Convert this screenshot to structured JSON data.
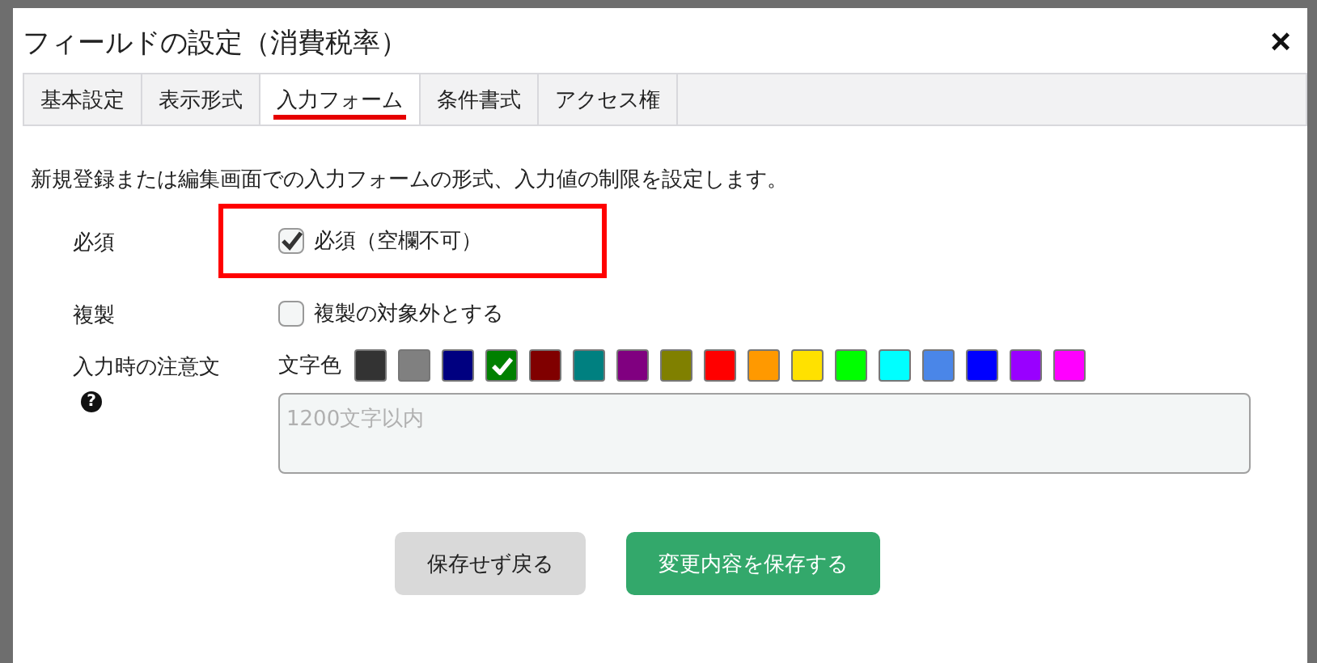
{
  "dialog": {
    "title": "フィールドの設定（消費税率）",
    "close": "×"
  },
  "tabs": [
    {
      "label": "基本設定",
      "selected": false
    },
    {
      "label": "表示形式",
      "selected": false
    },
    {
      "label": "入力フォーム",
      "selected": true
    },
    {
      "label": "条件書式",
      "selected": false
    },
    {
      "label": "アクセス権",
      "selected": false
    }
  ],
  "description": "新規登録または編集画面での入力フォームの形式、入力値の制限を設定します。",
  "settings": [
    {
      "kind": "checkbox",
      "label": "必須",
      "option": "必須（空欄不可）",
      "checked": true,
      "highlighted": true
    },
    {
      "kind": "checkbox",
      "label": "複製",
      "option": "複製の対象外とする",
      "checked": false,
      "highlighted": false
    },
    {
      "kind": "note",
      "label": "入力時の注意文",
      "help": "?",
      "color_label": "文字色",
      "placeholder": "1200文字以内",
      "swatches": [
        {
          "color": "#333333",
          "selected": false
        },
        {
          "color": "#808080",
          "selected": false
        },
        {
          "color": "#000080",
          "selected": false
        },
        {
          "color": "#008000",
          "selected": true
        },
        {
          "color": "#800000",
          "selected": false
        },
        {
          "color": "#008080",
          "selected": false
        },
        {
          "color": "#800080",
          "selected": false
        },
        {
          "color": "#808000",
          "selected": false
        },
        {
          "color": "#ff0000",
          "selected": false
        },
        {
          "color": "#ff9900",
          "selected": false
        },
        {
          "color": "#ffe100",
          "selected": false
        },
        {
          "color": "#00ff00",
          "selected": false
        },
        {
          "color": "#00ffff",
          "selected": false
        },
        {
          "color": "#4a86e8",
          "selected": false
        },
        {
          "color": "#0000ff",
          "selected": false
        },
        {
          "color": "#9900ff",
          "selected": false
        },
        {
          "color": "#ff00ff",
          "selected": false
        }
      ]
    }
  ],
  "buttons": [
    {
      "kind": "secondary",
      "label": "保存せず戻る"
    },
    {
      "kind": "primary",
      "label": "変更内容を保存する"
    }
  ]
}
